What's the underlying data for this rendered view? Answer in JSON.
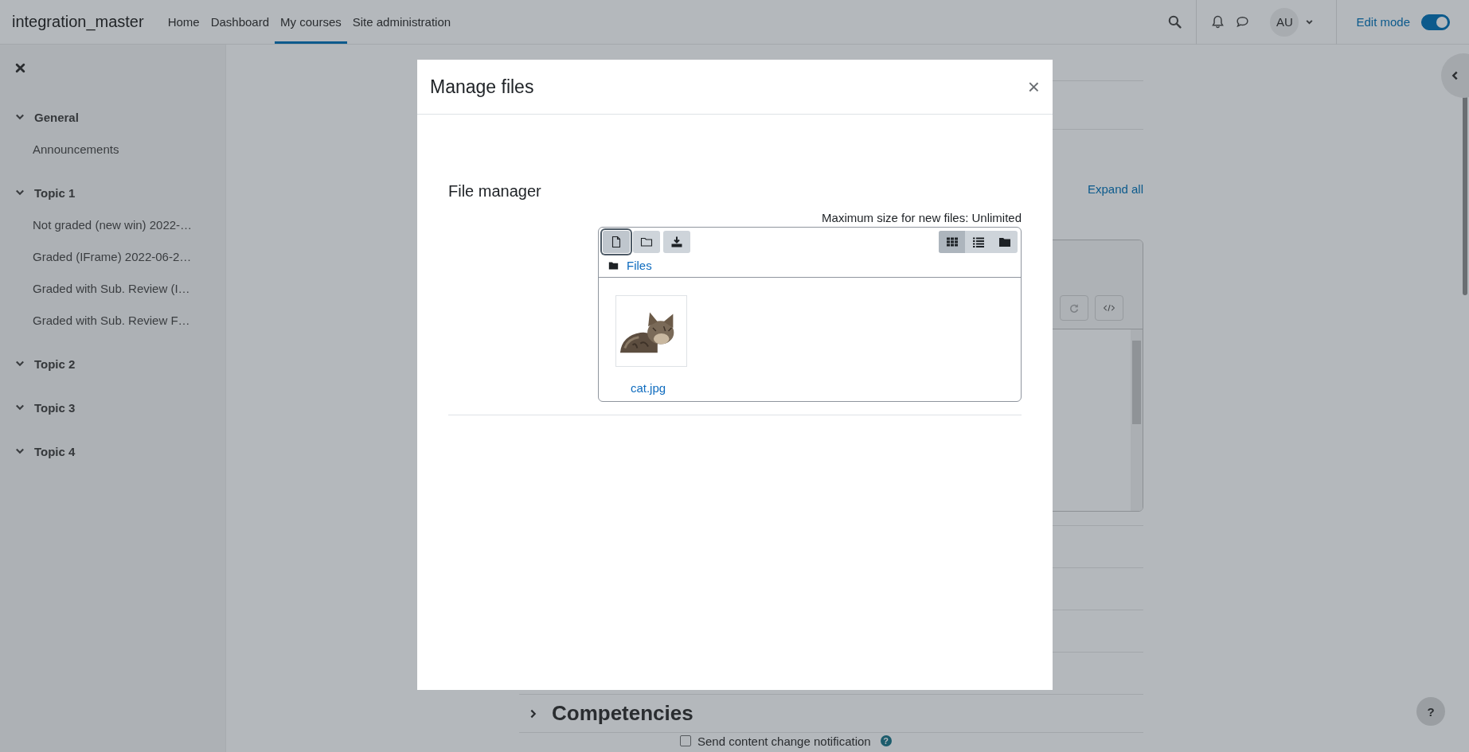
{
  "navbar": {
    "brand": "integration_master",
    "links": [
      {
        "label": "Home",
        "selected": false
      },
      {
        "label": "Dashboard",
        "selected": false
      },
      {
        "label": "My courses",
        "selected": true
      },
      {
        "label": "Site administration",
        "selected": false
      }
    ],
    "user_initials": "AU",
    "edit_mode": {
      "label": "Edit mode",
      "on": true
    }
  },
  "sidebar": {
    "sections": [
      {
        "title": "General",
        "expanded": true,
        "children": [
          {
            "title": "Announcements"
          }
        ]
      },
      {
        "title": "Topic 1",
        "expanded": true,
        "children": [
          {
            "title": "Not graded (new win) 2022-…"
          },
          {
            "title": "Graded (IFrame) 2022-06-2…"
          },
          {
            "title": "Graded with Sub. Review (I…"
          },
          {
            "title": "Graded with Sub. Review F…"
          }
        ]
      },
      {
        "title": "Topic 2",
        "expanded": true
      },
      {
        "title": "Topic 3",
        "expanded": true
      },
      {
        "title": "Topic 4",
        "expanded": true
      }
    ]
  },
  "course": {
    "expand_all": "Expand all",
    "section": {
      "title": "Competencies",
      "expanded": false
    },
    "notify": {
      "label": "Send content change notification",
      "checked": false,
      "help": "?"
    }
  },
  "help_button": "?",
  "dialog": {
    "title": "Manage files",
    "close": "×",
    "field_label": "File manager",
    "max_size": "Maximum size for new files: Unlimited",
    "toolbar": [
      {
        "kind": "add-file",
        "focused": true
      },
      {
        "kind": "create-folder",
        "focused": false
      },
      {
        "kind": "download",
        "focused": false
      }
    ],
    "views": [
      {
        "kind": "icons",
        "selected": true
      },
      {
        "kind": "list",
        "selected": false
      },
      {
        "kind": "tree",
        "selected": false
      }
    ],
    "path": "Files",
    "files": [
      {
        "name": "cat.jpg",
        "kind": "picture"
      }
    ]
  }
}
